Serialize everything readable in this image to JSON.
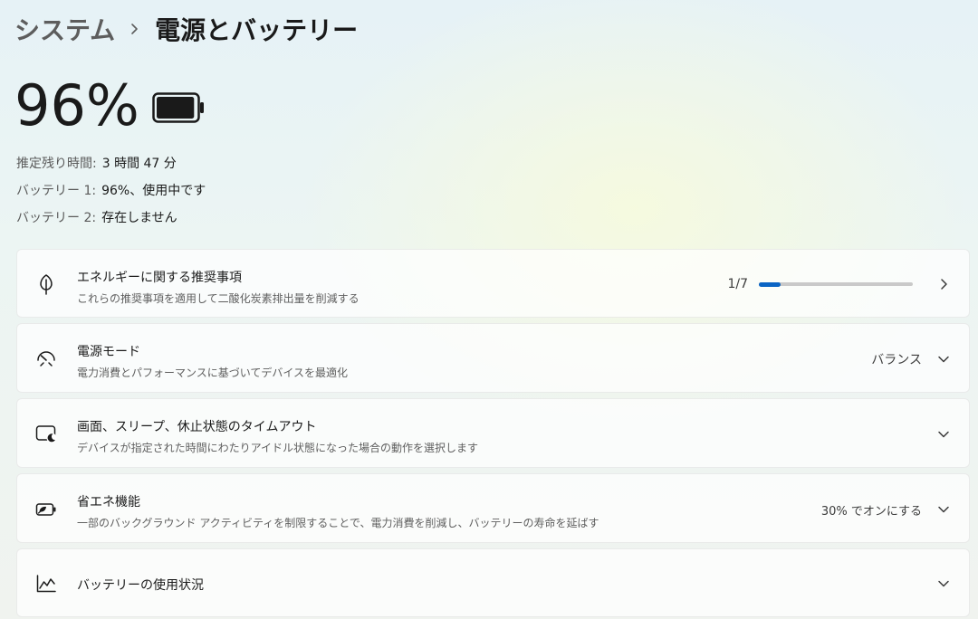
{
  "breadcrumb": {
    "parent": "システム",
    "separator_icon": "chevron-right-icon",
    "current": "電源とバッテリー"
  },
  "battery": {
    "percent_text": "96%",
    "level": 0.96,
    "icon": "battery-full-icon",
    "info": [
      {
        "label": "推定残り時間:",
        "value": "3 時間 47 分"
      },
      {
        "label": "バッテリー 1:",
        "value": "96%、使用中です"
      },
      {
        "label": "バッテリー 2:",
        "value": "存在しません"
      }
    ]
  },
  "cards": {
    "energy": {
      "title": "エネルギーに関する推奨事項",
      "subtitle": "これらの推奨事項を適用して二酸化炭素排出量を削減する",
      "progress_text": "1/7",
      "progress": {
        "done": 1,
        "total": 7
      },
      "icon": "leaf-icon",
      "action_icon": "chevron-right-icon"
    },
    "power_mode": {
      "title": "電源モード",
      "subtitle": "電力消費とパフォーマンスに基づいてデバイスを最適化",
      "value": "バランス",
      "icon": "speedometer-icon",
      "action_icon": "chevron-down-icon"
    },
    "screen_sleep": {
      "title": "画面、スリープ、休止状態のタイムアウト",
      "subtitle": "デバイスが指定された時間にわたりアイドル状態になった場合の動作を選択します",
      "icon": "screen-sleep-icon",
      "action_icon": "chevron-down-icon"
    },
    "energy_saver": {
      "title": "省エネ機能",
      "subtitle": "一部のバックグラウンド アクティビティを制限することで、電力消費を削減し、バッテリーの寿命を延ばす",
      "value": "30% でオンにする",
      "icon": "battery-saver-icon",
      "action_icon": "chevron-down-icon"
    },
    "battery_usage": {
      "title": "バッテリーの使用状況",
      "icon": "usage-chart-icon",
      "action_icon": "chevron-down-icon"
    }
  },
  "colors": {
    "accent": "#0a64c4",
    "track": "#c9c9c9"
  }
}
